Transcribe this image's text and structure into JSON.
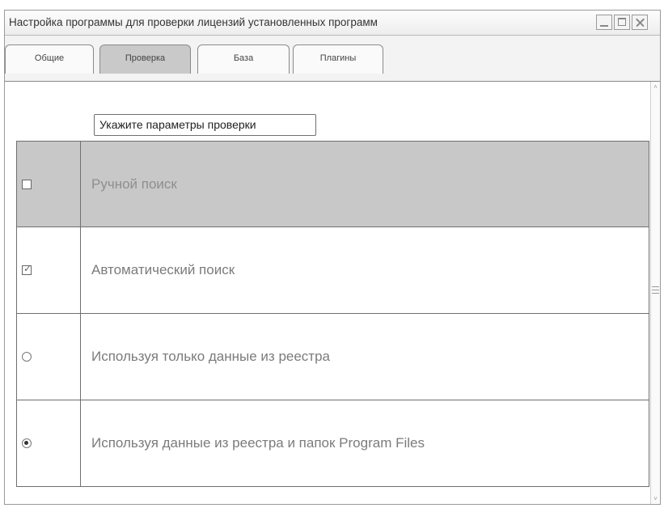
{
  "window": {
    "title": "Настройка программы для проверки лицензий установленных программ"
  },
  "tabs": [
    {
      "label": "Общие",
      "active": false
    },
    {
      "label": "Проверка",
      "active": true
    },
    {
      "label": "База",
      "active": false
    },
    {
      "label": "Плагины",
      "active": false
    }
  ],
  "check": {
    "group_label": "Укажите параметры проверки",
    "options": [
      {
        "label": "Ручной поиск",
        "control": "checkbox",
        "checked": false,
        "highlighted": true
      },
      {
        "label": "Автоматический поиск",
        "control": "checkbox",
        "checked": true,
        "highlighted": false
      },
      {
        "label": "Используя только данные из реестра",
        "control": "radio",
        "checked": false,
        "highlighted": false
      },
      {
        "label": "Используя данные из реестра и папок Program Files",
        "control": "radio",
        "checked": true,
        "highlighted": false
      }
    ]
  },
  "colors": {
    "highlight_row": "#c8c8c8",
    "active_tab": "#c9c9c9"
  }
}
